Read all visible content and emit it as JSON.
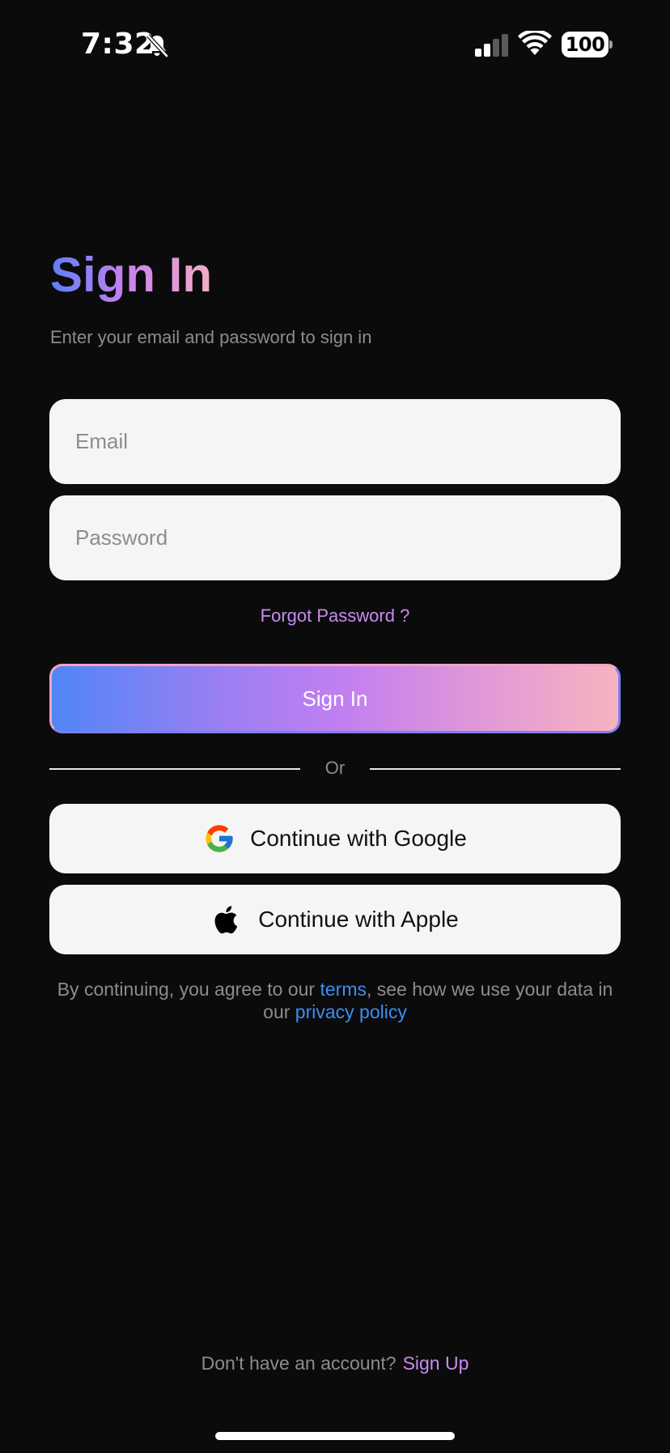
{
  "status_bar": {
    "time": "7:32",
    "battery": "100",
    "icons": [
      "bell-slash-icon",
      "cellular-signal-icon",
      "wifi-icon",
      "battery-icon"
    ]
  },
  "header": {
    "title": "Sign In",
    "subtitle": "Enter your email and password to sign in"
  },
  "form": {
    "email_placeholder": "Email",
    "email_value": "",
    "password_placeholder": "Password",
    "password_value": "",
    "forgot_label": "Forgot Password ?",
    "sign_in_label": "Sign In",
    "divider_label": "Or"
  },
  "social": {
    "google_label": "Continue with Google",
    "google_icon": "google-logo-icon",
    "apple_label": "Continue with Apple",
    "apple_icon": "apple-logo-icon"
  },
  "legal": {
    "prefix": "By continuing, you agree to our ",
    "terms_label": "terms",
    "middle": ", see how we use your data in our ",
    "privacy_label": "privacy policy"
  },
  "footer": {
    "prompt": "Don't have an account?",
    "signup_label": "Sign Up"
  },
  "colors": {
    "background": "#0b0b0c",
    "field_bg": "#f5f5f5",
    "accent_purple": "#c98bf0",
    "link_blue": "#3b8ef5",
    "gradient_start": "#4f86f6",
    "gradient_end": "#f7b3c0"
  }
}
